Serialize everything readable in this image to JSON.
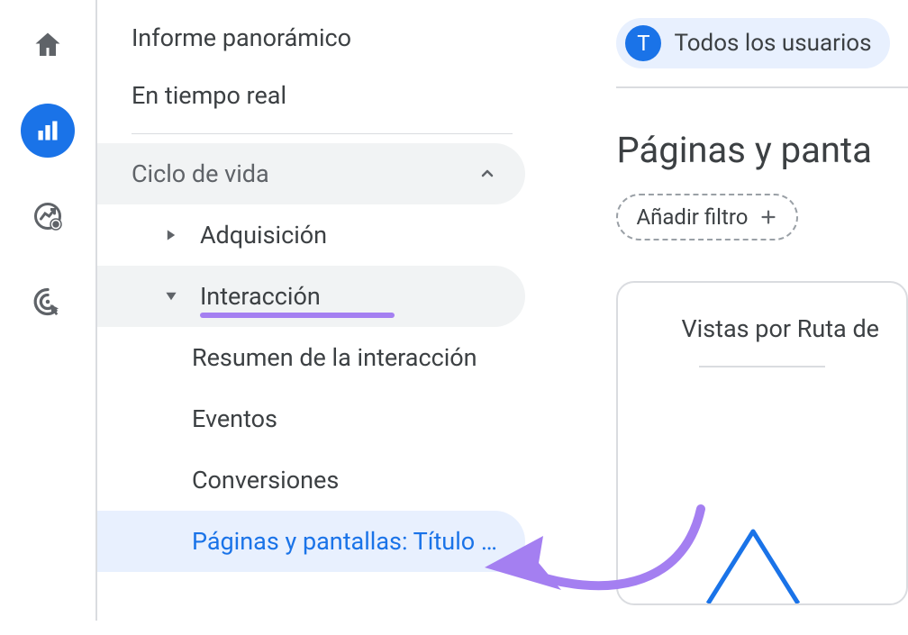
{
  "rail": {
    "home": "home-icon",
    "reports": "bar-chart-icon",
    "explore": "trend-icon",
    "ads": "target-icon"
  },
  "nav": {
    "overview": "Informe panorámico",
    "realtime": "En tiempo real",
    "lifecycle_header": "Ciclo de vida",
    "acquisition": "Adquisición",
    "engagement": "Interacción",
    "engagement_sub": {
      "summary": "Resumen de la interacción",
      "events": "Eventos",
      "conversions": "Conversiones",
      "pages": "Páginas y pantallas: Título …"
    }
  },
  "main": {
    "audience_badge": "T",
    "audience_label": "Todos los usuarios",
    "page_title": "Páginas y panta",
    "add_filter": "Añadir filtro",
    "chart_title": "Vistas por Ruta de"
  }
}
